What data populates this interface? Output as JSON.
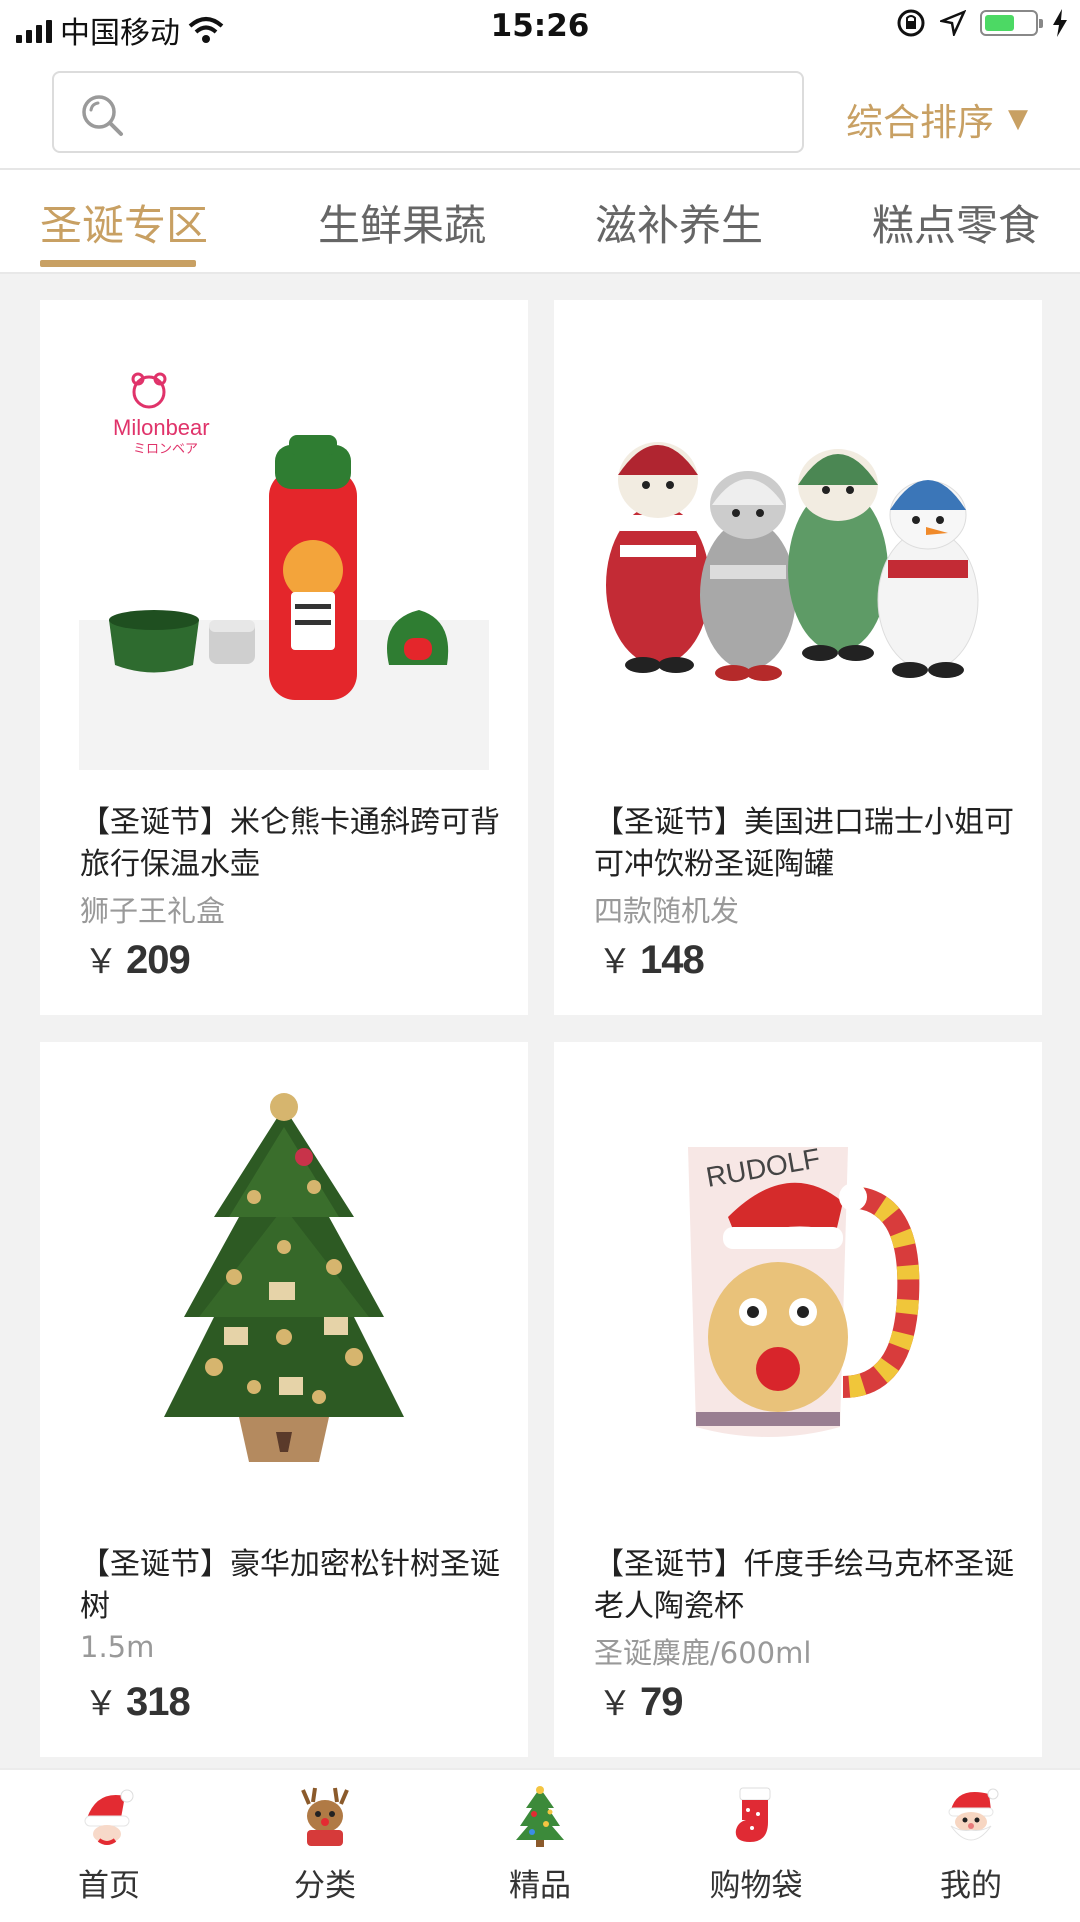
{
  "status_bar": {
    "carrier": "中国移动",
    "time": "15:26",
    "battery_level": 0.6
  },
  "search": {
    "placeholder": "",
    "value": "",
    "sort_label": "综合排序"
  },
  "tabs": [
    {
      "label": "圣诞专区",
      "active": true
    },
    {
      "label": "生鲜果蔬",
      "active": false
    },
    {
      "label": "滋补养生",
      "active": false
    },
    {
      "label": "糕点零食",
      "active": false
    }
  ],
  "products": [
    {
      "title": "【圣诞节】米仑熊卡通斜跨可背旅行保温水壶",
      "subtitle": "狮子王礼盒",
      "currency": "￥",
      "price": "209",
      "image_brand": "Milonbear",
      "image_brand_sub": "ミロンベア"
    },
    {
      "title": "【圣诞节】美国进口瑞士小姐可可冲饮粉圣诞陶罐",
      "subtitle": "四款随机发",
      "currency": "￥",
      "price": "148"
    },
    {
      "title": "【圣诞节】豪华加密松针树圣诞树",
      "subtitle": "1.5m",
      "currency": "￥",
      "price": "318"
    },
    {
      "title": "【圣诞节】仟度手绘马克杯圣诞老人陶瓷杯",
      "subtitle": "圣诞麋鹿/600ml",
      "currency": "￥",
      "price": "79",
      "image_text": "RUDOLF"
    }
  ],
  "bottom_nav": [
    {
      "label": "首页",
      "icon": "santa-hat-icon"
    },
    {
      "label": "分类",
      "icon": "reindeer-icon"
    },
    {
      "label": "精品",
      "icon": "christmas-tree-icon"
    },
    {
      "label": "购物袋",
      "icon": "stocking-icon"
    },
    {
      "label": "我的",
      "icon": "santa-face-icon"
    }
  ],
  "colors": {
    "accent": "#c8a063",
    "background": "#f2f2f2"
  }
}
